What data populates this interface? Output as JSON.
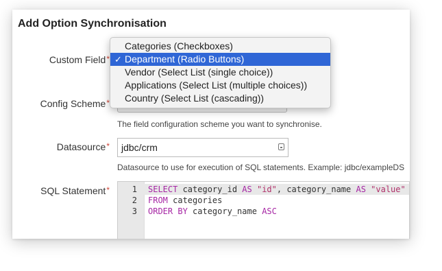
{
  "dialog": {
    "title": "Add Option Synchronisation"
  },
  "form": {
    "required_marker": "*",
    "custom_field": {
      "label": "Custom Field",
      "options": [
        "Categories (Checkboxes)",
        "Department (Radio Buttons)",
        "Vendor (Select List (single choice))",
        "Applications (Select List (multiple choices))",
        "Country (Select List (cascading))"
      ],
      "selected_index": 1,
      "selected_mark": "✓"
    },
    "config_scheme": {
      "label": "Config Scheme",
      "hint": "The field configuration scheme you want to synchronise."
    },
    "datasource": {
      "label": "Datasource",
      "value": "jdbc/crm",
      "hint": "Datasource to use for execution of SQL statements. Example: jdbc/exampleDS"
    },
    "sql_statement": {
      "label": "SQL Statement",
      "lines": [
        {
          "number": "1",
          "tokens": [
            {
              "t": "SELECT ",
              "c": "kw"
            },
            {
              "t": "category_id ",
              "c": ""
            },
            {
              "t": "AS ",
              "c": "kw"
            },
            {
              "t": "\"id\"",
              "c": "str"
            },
            {
              "t": ", category_name ",
              "c": ""
            },
            {
              "t": "AS ",
              "c": "kw"
            },
            {
              "t": "\"value\"",
              "c": "str"
            }
          ]
        },
        {
          "number": "2",
          "tokens": [
            {
              "t": "FROM ",
              "c": "kw"
            },
            {
              "t": "categories",
              "c": ""
            }
          ]
        },
        {
          "number": "3",
          "tokens": [
            {
              "t": "ORDER BY ",
              "c": "kw"
            },
            {
              "t": "category_name ",
              "c": ""
            },
            {
              "t": "ASC",
              "c": "kw"
            }
          ]
        }
      ]
    }
  }
}
